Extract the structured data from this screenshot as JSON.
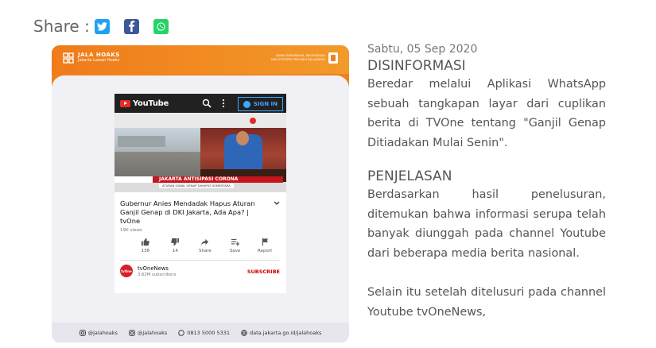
{
  "share": {
    "label": "Share :",
    "icons": [
      "twitter-icon",
      "facebook-icon",
      "whatsapp-icon"
    ],
    "colors": {
      "twitter": "#1da1f2",
      "facebook": "#3b5998",
      "whatsapp": "#25d366"
    }
  },
  "card": {
    "brand_name": "JALA HOAKS",
    "brand_tagline": "Jakarta Lawan Hoaks",
    "gov_line1": "DINAS KOMUNIKASI, INFORMATIKA",
    "gov_line2": "DAN STATISTIK PROVINSI DKI JAKARTA",
    "accent_color": "#f07b1a",
    "youtube": {
      "logo_text": "YouTube",
      "signin_label": "SIGN IN",
      "lower_third_tag": "JAKARTA",
      "lower_third_title": "JAKARTA ANTISIPASI CORONA",
      "lower_third_sub": "ATURAN GANJIL GENAP DIHAPUS SEMENTARA",
      "video_title": "Gubernur Anies Mendadak Hapus Aturan Ganjil Genap di DKI Jakarta, Ada Apa? | tvOne",
      "views": "19K views",
      "actions": [
        {
          "icon": "thumbs-up-icon",
          "label": "138"
        },
        {
          "icon": "thumbs-down-icon",
          "label": "14"
        },
        {
          "icon": "share-icon",
          "label": "Share"
        },
        {
          "icon": "playlist-add-icon",
          "label": "Save"
        },
        {
          "icon": "flag-icon",
          "label": "Report"
        }
      ],
      "channel_name": "tvOneNews",
      "channel_subs": "3.62M subscribers",
      "subscribe_label": "SUBSCRIBE",
      "avatar_text": "tvOne"
    },
    "footer": [
      {
        "icon": "instagram-icon",
        "label": "@jalahoaks"
      },
      {
        "icon": "instagram-icon",
        "label": "@jalahoaks"
      },
      {
        "icon": "whatsapp-icon",
        "label": "0813 5000 5331"
      },
      {
        "icon": "globe-icon",
        "label": "data.jakarta.go.id/jalahoaks"
      }
    ]
  },
  "article": {
    "date": "Sabtu, 05 Sep 2020",
    "heading1": "DISINFORMASI",
    "para1": "Beredar melalui Aplikasi WhatsApp sebuah tangkapan layar dari cuplikan berita di TVOne tentang \"Ganjil Genap Ditiadakan Mulai Senin\".",
    "heading2": "PENJELASAN",
    "para2": "Berdasarkan hasil penelusuran, ditemukan bahwa informasi serupa telah banyak diunggah pada channel Youtube dari beberapa media berita nasional.",
    "para3": "Selain itu setelah ditelusuri pada channel Youtube tvOneNews,"
  }
}
